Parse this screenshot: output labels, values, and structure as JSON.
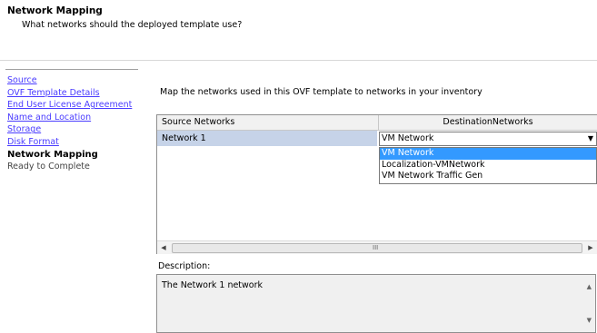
{
  "header": {
    "title": "Network Mapping",
    "subtitle": "What networks should the deployed template use?"
  },
  "sidebar": {
    "items": [
      {
        "label": "Source",
        "state": "link"
      },
      {
        "label": "OVF Template Details",
        "state": "link"
      },
      {
        "label": "End User License Agreement",
        "state": "link"
      },
      {
        "label": "Name and Location",
        "state": "link"
      },
      {
        "label": "Storage",
        "state": "link"
      },
      {
        "label": "Disk Format",
        "state": "link"
      },
      {
        "label": "Network Mapping",
        "state": "current"
      },
      {
        "label": "Ready to Complete",
        "state": "disabled"
      }
    ]
  },
  "main": {
    "instruction": "Map the networks used in this OVF template to networks in your inventory",
    "table": {
      "headers": [
        "Source Networks",
        "DestinationNetworks"
      ],
      "rows": [
        {
          "source": "Network 1",
          "destination": "VM Network"
        }
      ]
    },
    "dropdown": {
      "options": [
        "VM Network",
        "Localization-VMNetwork",
        "VM Network Traffic Gen"
      ],
      "selected": "VM Network"
    },
    "scrollbar_grip": "III",
    "description_label": "Description:",
    "description_text": "The Network 1 network"
  },
  "colors": {
    "link": "#4a3cff",
    "row_selected": "#c6d3e8",
    "dropdown_highlight": "#3399ff"
  }
}
